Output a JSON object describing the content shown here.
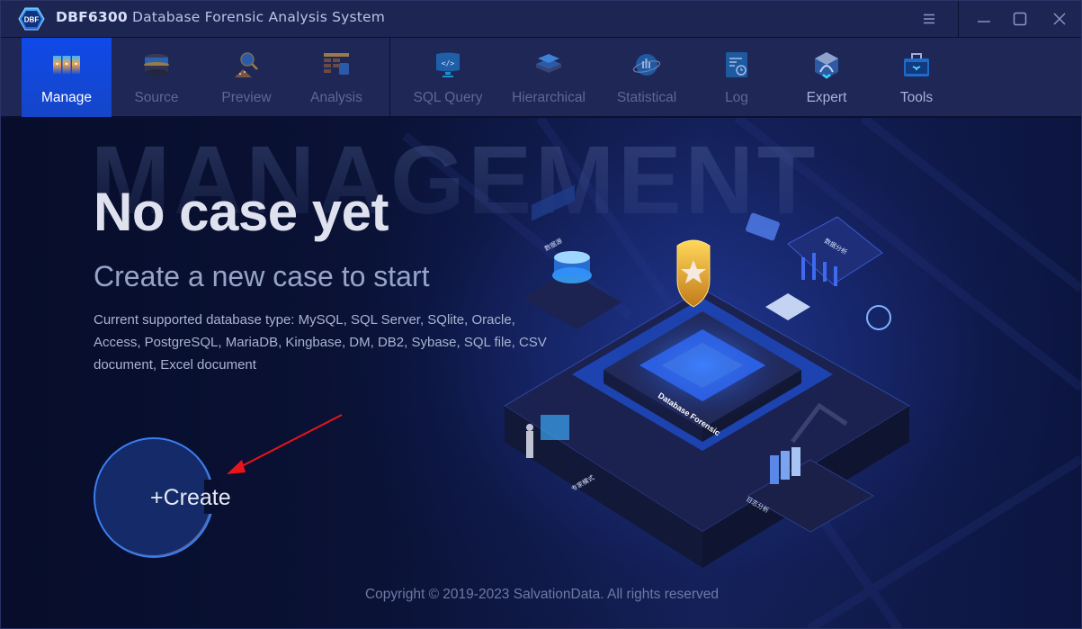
{
  "window": {
    "app_code": "DBF6300",
    "app_name": "Database Forensic Analysis System",
    "logo_text": "DBF",
    "controls": {
      "menu_icon": "hamburger-menu-icon",
      "minimize_icon": "minimize-icon",
      "maximize_icon": "maximize-icon",
      "close_icon": "close-icon"
    }
  },
  "toolbar": {
    "items": [
      {
        "label": "Manage",
        "icon": "case-folders-icon",
        "state": "active"
      },
      {
        "label": "Source",
        "icon": "database-source-icon",
        "state": "disabled"
      },
      {
        "label": "Preview",
        "icon": "magnifier-preview-icon",
        "state": "disabled"
      },
      {
        "label": "Analysis",
        "icon": "table-analysis-icon",
        "state": "disabled"
      },
      {
        "label": "SQL Query",
        "icon": "sql-code-icon",
        "state": "disabled"
      },
      {
        "label": "Hierarchical",
        "icon": "layers-icon",
        "state": "disabled"
      },
      {
        "label": "Statistical",
        "icon": "chart-globe-icon",
        "state": "disabled"
      },
      {
        "label": "Log",
        "icon": "log-clock-icon",
        "state": "disabled"
      },
      {
        "label": "Expert",
        "icon": "expert-cube-icon",
        "state": "enabled"
      },
      {
        "label": "Tools",
        "icon": "toolbox-icon",
        "state": "enabled"
      }
    ]
  },
  "main": {
    "watermark": "MANAGEMENT",
    "headline": "No case yet",
    "subheadline": "Create a new case to start",
    "description": "Current supported database type: MySQL, SQL Server, SQlite, Oracle, Access, PostgreSQL, MariaDB, Kingbase, DM, DB2, Sybase, SQL file, CSV document, Excel document",
    "create_button": {
      "plus": "+",
      "label": "Create"
    },
    "illustration": {
      "center_label": "Database Forensic",
      "panel_labels": [
        "数据源",
        "数据分析",
        "专家模式",
        "日志分析"
      ]
    },
    "copyright": "Copyright © 2019-2023  SalvationData. All rights reserved"
  },
  "annotation": {
    "type": "arrow",
    "color": "#e8141a",
    "points_to": "create-button"
  }
}
